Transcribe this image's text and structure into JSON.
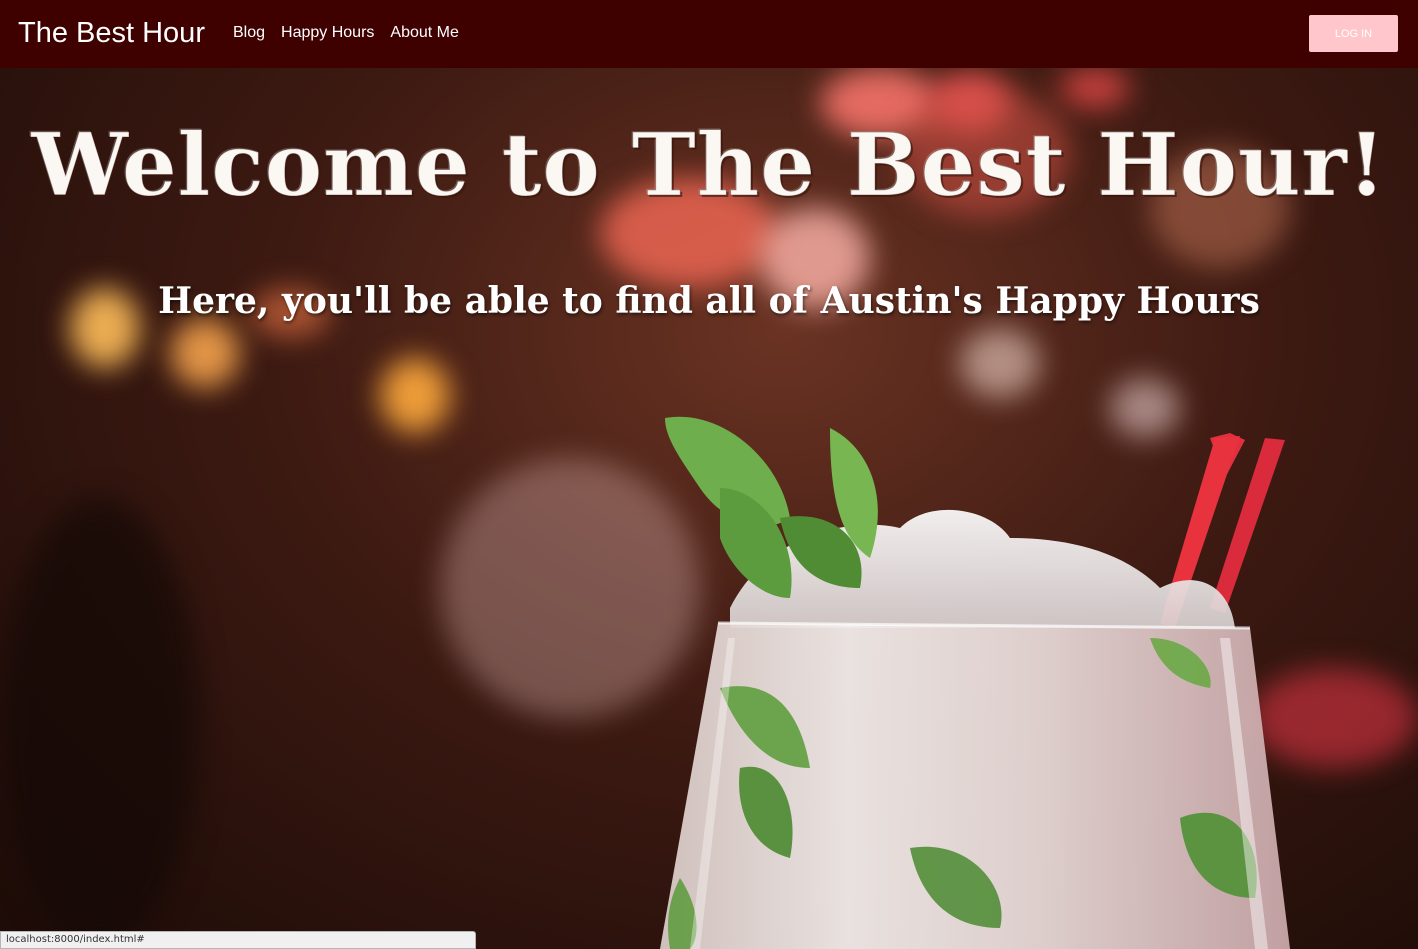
{
  "navbar": {
    "brand": "The Best Hour",
    "links": [
      {
        "label": "Blog"
      },
      {
        "label": "Happy Hours"
      },
      {
        "label": "About Me"
      }
    ],
    "login_label": "LOG IN"
  },
  "hero": {
    "title": "Welcome to The Best Hour!",
    "subtitle": "Here, you'll be able to find all of Austin's Happy Hours",
    "image_subject": "mojito-cocktail-with-mint-and-red-straw"
  },
  "status_bar": {
    "url": "localhost:8000/index.html#"
  },
  "colors": {
    "navbar_bg": "#3f0000",
    "login_button_bg": "#ffc7cc",
    "text": "#ffffff"
  }
}
